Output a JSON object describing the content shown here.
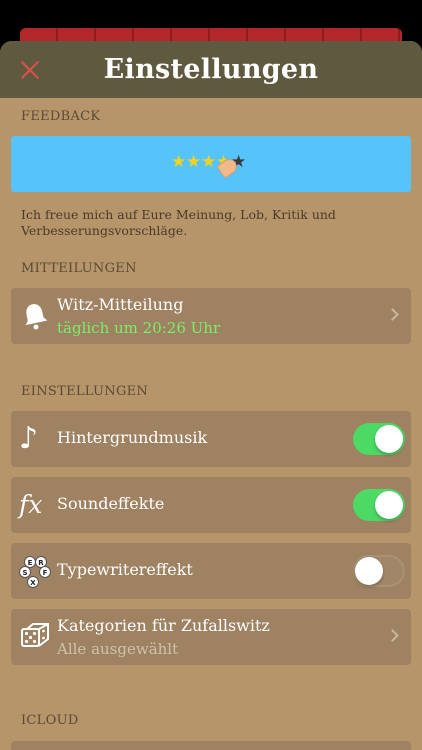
{
  "nav": {
    "title": "Einstellungen"
  },
  "feedback": {
    "header": "FEEDBACK",
    "note": "Ich freue mich auf Eure Meinung, Lob, Kritik und Verbesserungsvorschläge."
  },
  "notifications": {
    "header": "MITTEILUNGEN",
    "joke": {
      "label": "Witz-Mitteilung",
      "schedule": "täglich um 20:26 Uhr",
      "icon": "bell-icon"
    }
  },
  "settings": {
    "header": "EINSTELLUNGEN",
    "music": {
      "label": "Hintergrundmusik",
      "on": true,
      "icon": "music-note-icon"
    },
    "sound": {
      "label": "Soundeffekte",
      "on": true,
      "icon": "fx-icon"
    },
    "typewriter": {
      "label": "Typewritereffekt",
      "on": false,
      "icon": "keyboard-keys-icon",
      "keys": [
        "E",
        "R",
        "S",
        "F",
        "X"
      ]
    },
    "categories": {
      "label": "Kategorien für Zufallswitz",
      "value": "Alle ausgewählt",
      "icon": "dice-icon"
    }
  },
  "icloud": {
    "header": "ICLOUD"
  },
  "colors": {
    "nav_bg": "#5f5a3f",
    "sheet_bg": "#b7956b",
    "row_bg": "#9e8262",
    "banner_bg": "#56c3fb",
    "toggle_on": "#4cd964",
    "close_accent": "#e0504a",
    "schedule_green": "#7cee69"
  }
}
